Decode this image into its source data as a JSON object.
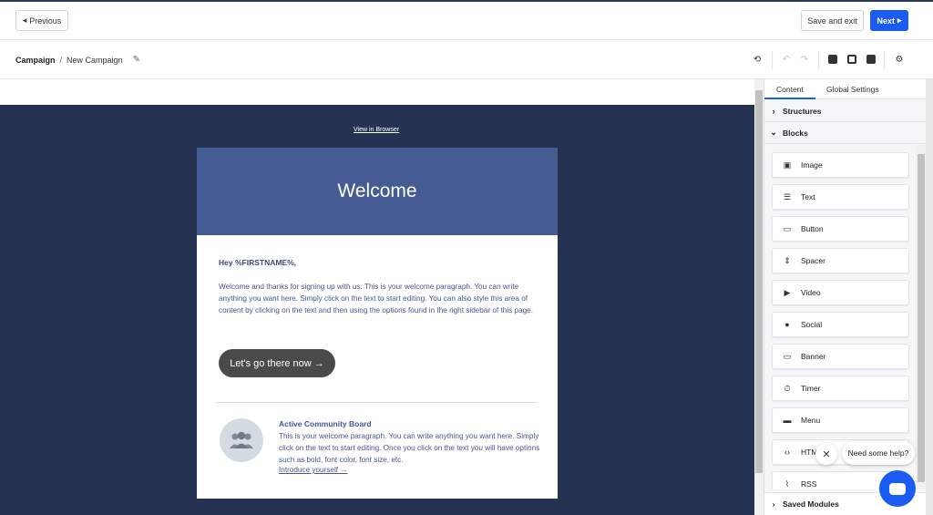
{
  "topbar": {
    "previous_label": "Previous",
    "save_label": "Save and exit",
    "next_label": "Next"
  },
  "breadcrumb": {
    "root": "Campaign",
    "separator": "/",
    "current": "New Campaign"
  },
  "email": {
    "view_in_browser": "View in Browser",
    "hero_title": "Welcome",
    "greeting": "Hey %FIRSTNAME%,",
    "paragraph": "Welcome and thanks for signing up with us. This is your welcome paragraph. You can write anything you want here. Simply click on the text to start editing. You can also style this area of content by clicking on the text and then using the options found in the right sidebar of this page.",
    "cta": "Let's go there now →",
    "community_title": "Active Community Board",
    "community_text": "This is your welcome paragraph. You can write anything you want here. Simply click on the text to start editing. Once you click on the text you will have options such as bold, font color, font size, etc.",
    "community_link": "Introduce yourself →"
  },
  "sidebar": {
    "tabs": [
      "Content",
      "Global Settings"
    ],
    "structures_label": "Structures",
    "blocks_label": "Blocks",
    "blocks": [
      "Image",
      "Text",
      "Button",
      "Spacer",
      "Video",
      "Social",
      "Banner",
      "Timer",
      "Menu",
      "HTML",
      "RSS"
    ],
    "saved_modules_label": "Saved Modules"
  },
  "chat": {
    "prompt": "Need some help?"
  },
  "colors": {
    "accent": "#1a5bf2",
    "canvas_bg": "#263251",
    "hero_bg": "#455b93"
  }
}
